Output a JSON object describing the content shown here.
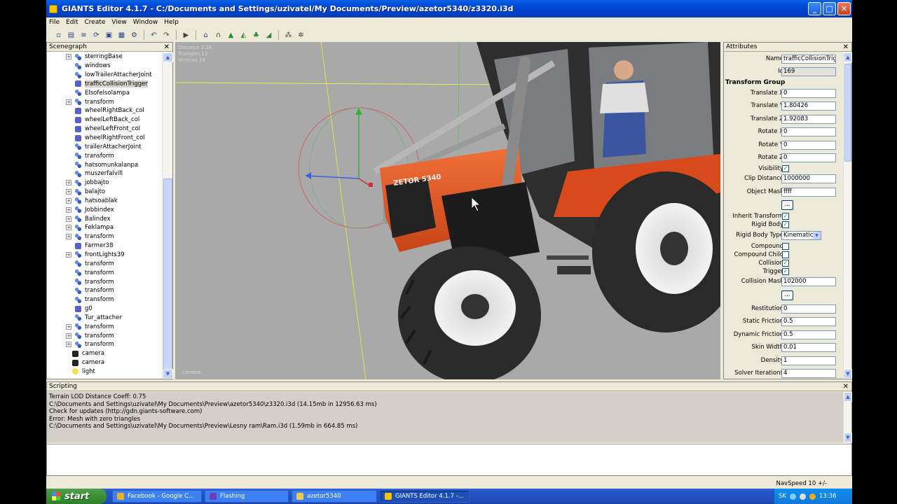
{
  "window": {
    "title": "GIANTS Editor 4.1.7 - C:/Documents and Settings/uzivatel/My Documents/Preview/azetor5340/z3320.i3d"
  },
  "menu": [
    "File",
    "Edit",
    "Create",
    "View",
    "Window",
    "Help"
  ],
  "toolbar_icons": [
    "new-icon",
    "open-icon",
    "list-icon",
    "reload-icon",
    "save-icon",
    "save-all-icon",
    "tool-icon",
    "undo-icon",
    "redo-icon",
    "play-icon",
    "select-icon",
    "magnet-icon",
    "terrain-icon",
    "terrain-paint-icon",
    "foliage-icon",
    "terrain-sculpt-icon",
    "grid-icon",
    "snap-icon"
  ],
  "scenegraph": {
    "title": "Scenegraph",
    "items": [
      {
        "label": "sterringBase",
        "type": "transform",
        "exp": true
      },
      {
        "label": "windows",
        "type": "transform",
        "exp": false
      },
      {
        "label": "lowTrailerAttacherJoint",
        "type": "transform",
        "exp": false
      },
      {
        "label": "trafficCollisionTrigger",
        "type": "shape",
        "exp": false,
        "selected": true
      },
      {
        "label": "Elsofelsolampa",
        "type": "transform",
        "exp": false
      },
      {
        "label": "transform",
        "type": "transform",
        "exp": true
      },
      {
        "label": "wheelRightBack_col",
        "type": "shape",
        "exp": false
      },
      {
        "label": "wheelLeftBack_col",
        "type": "shape",
        "exp": false
      },
      {
        "label": "wheelLeftFront_col",
        "type": "shape",
        "exp": false
      },
      {
        "label": "wheelRightFront_col",
        "type": "shape",
        "exp": false
      },
      {
        "label": "trailerAttacherJoint",
        "type": "transform",
        "exp": false
      },
      {
        "label": "transform",
        "type": "transform",
        "exp": false
      },
      {
        "label": "hatsomunkalanpa",
        "type": "transform",
        "exp": false
      },
      {
        "label": "muszerfalvill",
        "type": "transform",
        "exp": false
      },
      {
        "label": "jobbajto",
        "type": "transform",
        "exp": true
      },
      {
        "label": "balajto",
        "type": "transform",
        "exp": true
      },
      {
        "label": "hatsoablak",
        "type": "transform",
        "exp": true
      },
      {
        "label": "Jobbindex",
        "type": "transform",
        "exp": true
      },
      {
        "label": "Balindex",
        "type": "transform",
        "exp": true
      },
      {
        "label": "Feklampa",
        "type": "transform",
        "exp": true
      },
      {
        "label": "transform",
        "type": "transform",
        "exp": true
      },
      {
        "label": "Farmer38",
        "type": "shape",
        "exp": false
      },
      {
        "label": "frontLights39",
        "type": "transform",
        "exp": true
      },
      {
        "label": "transform",
        "type": "transform",
        "exp": false
      },
      {
        "label": "transform",
        "type": "transform",
        "exp": false
      },
      {
        "label": "transform",
        "type": "transform",
        "exp": false
      },
      {
        "label": "transform",
        "type": "transform",
        "exp": false
      },
      {
        "label": "transform",
        "type": "transform",
        "exp": false
      },
      {
        "label": "g0",
        "type": "shape",
        "exp": false
      },
      {
        "label": "Tur_attacher",
        "type": "transform",
        "exp": false
      },
      {
        "label": "transform",
        "type": "transform",
        "exp": true
      },
      {
        "label": "transform",
        "type": "transform",
        "exp": true
      },
      {
        "label": "transform",
        "type": "transform",
        "exp": true
      },
      {
        "label": "camera",
        "type": "camera",
        "exp": false,
        "top": true
      },
      {
        "label": "camera",
        "type": "camera",
        "exp": false,
        "top": true
      },
      {
        "label": "light",
        "type": "light",
        "exp": false,
        "top": true
      }
    ]
  },
  "viewport": {
    "stats": [
      "Distance 2.16",
      "Triangles 12",
      "Vertices 24"
    ],
    "camera_label": "camera",
    "model_text": "ZETOR 5340"
  },
  "attributes": {
    "title": "Attributes",
    "name_label": "Name",
    "name_value": "trafficCollisionTrigge",
    "id_label": "Id",
    "id_value": "169",
    "section": "Transform Group",
    "tx_label": "Translate X",
    "tx": "0",
    "ty_label": "Translate Y",
    "ty": "1.80426",
    "tz_label": "Translate Z",
    "tz": "1.92083",
    "rx_label": "Rotate X",
    "rx": "0",
    "ry_label": "Rotate Y",
    "ry": "0",
    "rz_label": "Rotate Z",
    "rz": "0",
    "visibility_label": "Visibility",
    "clip_label": "Clip Distance",
    "clip": "1000000",
    "mask_label": "Object Mask",
    "mask": "ffff",
    "dots": "...",
    "inherit_label": "Inherit Transform",
    "rigid_label": "Rigid Body",
    "rigidtype_label": "Rigid Body Type",
    "rigidtype": "Kinematic",
    "compound_label": "Compound",
    "compoundchild_label": "Compound Child",
    "collision_label": "Collision",
    "trigger_label": "Trigger",
    "colmask_label": "Collision Mask",
    "colmask": "102000",
    "restitution_label": "Restitution",
    "restitution": "0",
    "sfric_label": "Static Friction",
    "sfric": "0.5",
    "dfric_label": "Dynamic Friction",
    "dfric": "0.5",
    "skin_label": "Skin Width",
    "skin": "0.01",
    "density_label": "Density",
    "density": "1",
    "solver_label": "Solver Iterations",
    "solver": "4",
    "check": "✓"
  },
  "scripting": {
    "title": "Scripting",
    "lines": [
      "  Terrain LOD Distance Coeff: 0.75",
      "C:\\Documents and Settings\\uzivatel\\My Documents\\Preview\\azetor5340\\z3320.i3d (14.15mb in 12956.63 ms)",
      "Check for updates (http://gdn.giants-software.com)",
      "Error: Mesh with zero triangles",
      "C:\\Documents and Settings\\uzivatel\\My Documents\\Preview\\Lesny ram\\Ram.i3d (1.59mb in 664.85 ms)"
    ]
  },
  "status": {
    "navspeed": "NavSpeed 10 +/-"
  },
  "taskbar": {
    "start": "start",
    "tasks": [
      {
        "label": "Facebook - Google C...",
        "color": "#e8b32a"
      },
      {
        "label": "Flashing",
        "color": "#6a3fb5"
      },
      {
        "label": "azetor5340",
        "color": "#f0c850"
      },
      {
        "label": "GIANTS Editor 4.1.7 -...",
        "color": "#f5c400",
        "active": true
      }
    ],
    "lang": "SK",
    "time": "13:36"
  }
}
